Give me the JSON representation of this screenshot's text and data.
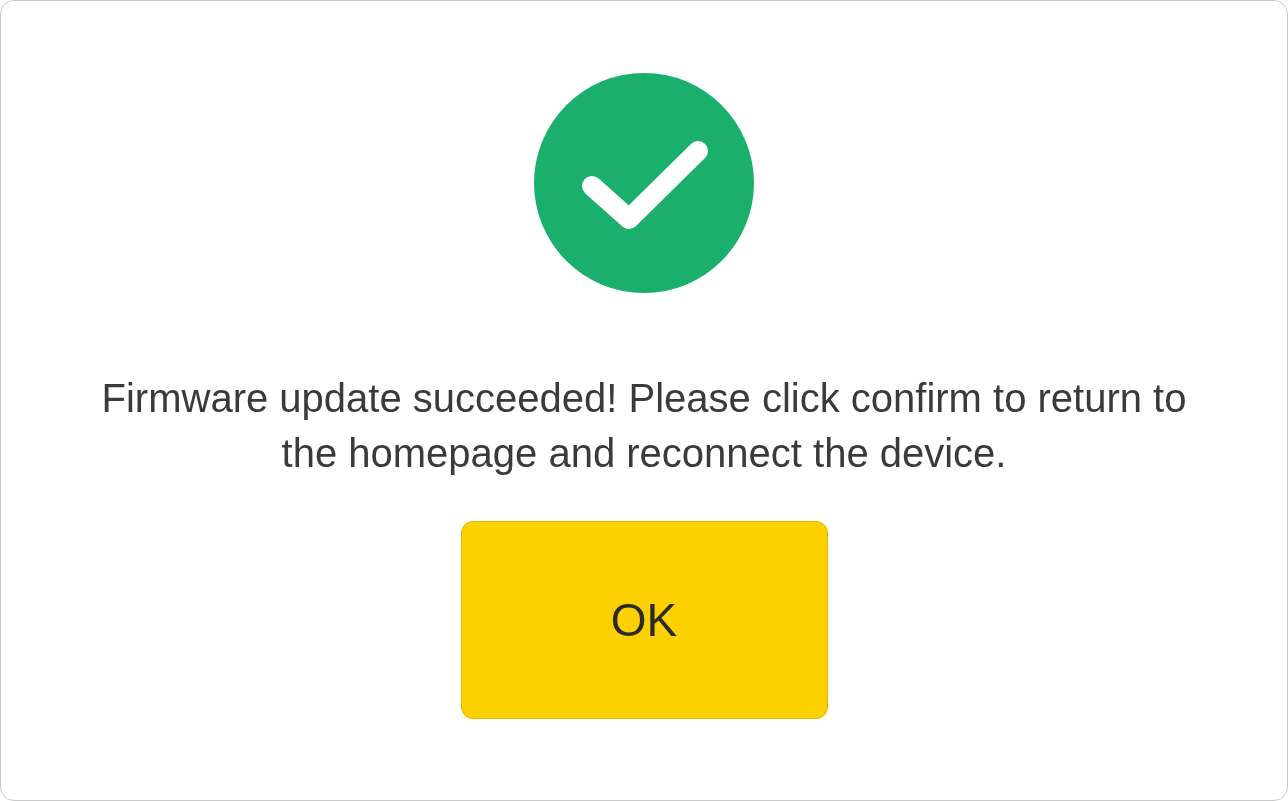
{
  "dialog": {
    "succeeded": true,
    "message": "Firmware update succeeded! Please click confirm to return to the homepage and reconnect the device.",
    "buttons": [
      {
        "label": "OK"
      }
    ]
  }
}
